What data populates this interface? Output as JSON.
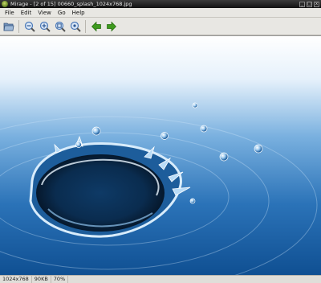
{
  "window": {
    "app_name": "Mirage",
    "title": "Mirage - [2 of 15] 00660_splash_1024x768.jpg",
    "controls": [
      "_",
      "□",
      "x"
    ]
  },
  "menu": [
    {
      "label": "File"
    },
    {
      "label": "Edit"
    },
    {
      "label": "View"
    },
    {
      "label": "Go"
    },
    {
      "label": "Help"
    }
  ],
  "toolbar": {
    "icons": [
      "open-folder-icon",
      "zoom-out-icon",
      "zoom-in-icon",
      "zoom-fit-icon",
      "zoom-100-icon",
      "previous-arrow-icon",
      "next-arrow-icon"
    ],
    "arrow_color": "#3e9a1e",
    "zoom_color": "#4a78b8"
  },
  "status": {
    "dimensions": "1024x768",
    "filesize": "90KB",
    "zoom": "70%"
  }
}
